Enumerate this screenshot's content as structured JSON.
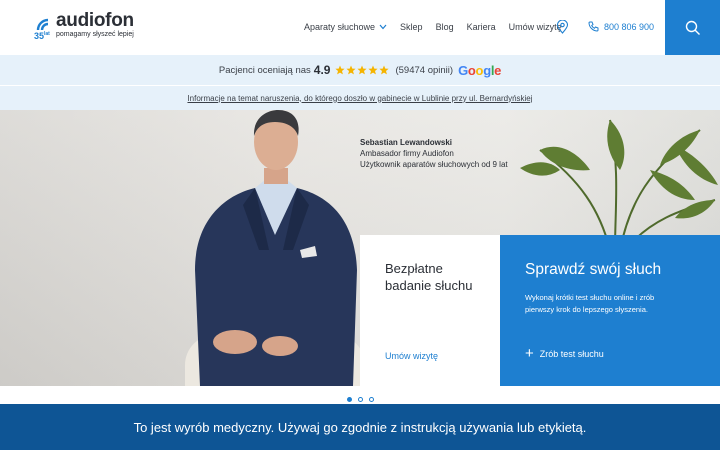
{
  "header": {
    "logo": {
      "word": "audiofon",
      "badge": "35",
      "badge_suffix": "lat",
      "tagline": "pomagamy słyszeć lepiej"
    },
    "nav": [
      {
        "label": "Aparaty słuchowe",
        "has_dropdown": true
      },
      {
        "label": "Sklep"
      },
      {
        "label": "Blog"
      },
      {
        "label": "Kariera"
      },
      {
        "label": "Umów wizytę"
      }
    ],
    "location_icon": "map-pin-icon",
    "phone": {
      "icon": "phone-icon",
      "number": "800 806 900"
    },
    "search_icon": "search-icon"
  },
  "rating": {
    "prefix": "Pacjenci oceniają nas",
    "score": "4.9",
    "stars": 5,
    "count": "(59474 opinii)",
    "provider": "Google"
  },
  "info_link": "Informacje na temat naruszenia, do którego doszło w gabinecie w Lublinie przy ul. Bernardyńskiej",
  "hero": {
    "caption": {
      "name": "Sebastian Lewandowski",
      "line2": "Ambasador firmy Audiofon",
      "line3": "Użytkownik aparatów słuchowych od 9 lat"
    },
    "card_free": {
      "title": "Bezpłatne badanie słuchu",
      "link": "Umów wizytę"
    },
    "card_test": {
      "title": "Sprawdź swój słuch",
      "text": "Wykonaj krótki test słuchu online i zrób pierwszy krok do lepszego słyszenia.",
      "cta": "Zrób test słuchu"
    },
    "slides": 3,
    "active_slide": 1
  },
  "banner": {
    "text": "To jest wyrób medyczny. Używaj go zgodnie z instrukcją używania lub etykietą."
  },
  "colors": {
    "primary": "#1e7fd0",
    "banner": "#0e5595",
    "strip": "#e6f1fa"
  }
}
